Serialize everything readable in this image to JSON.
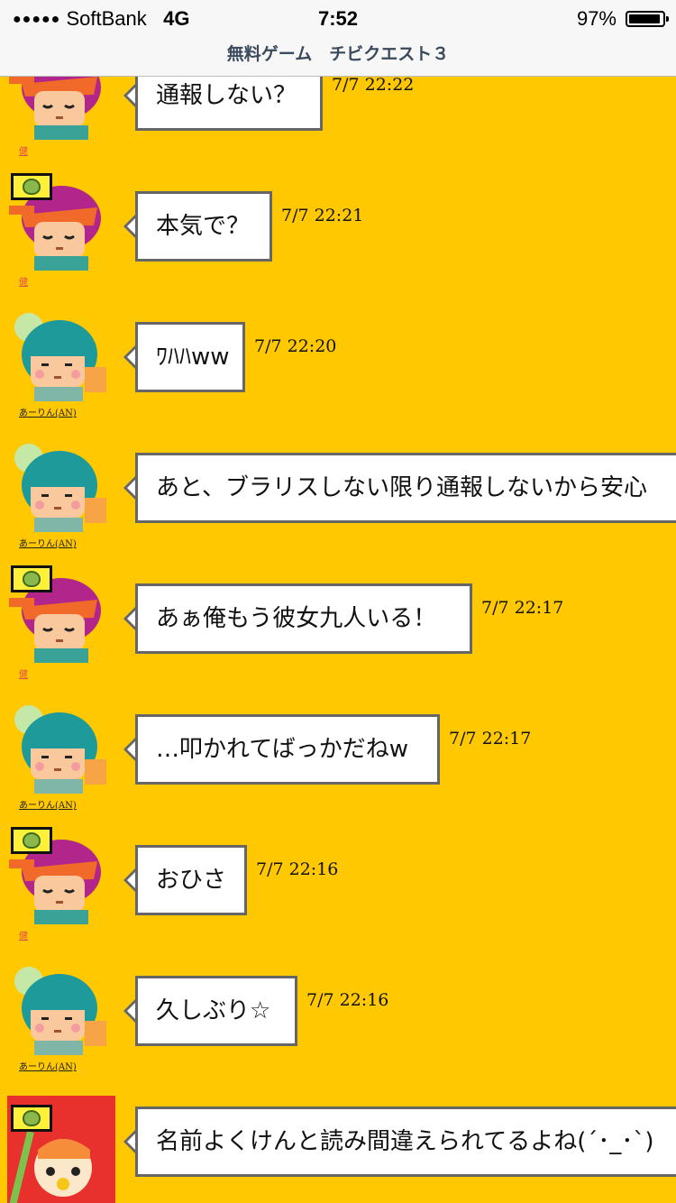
{
  "status_bar": {
    "carrier": "SoftBank",
    "network": "4G",
    "time": "7:52",
    "battery": "97%"
  },
  "header": {
    "title": "無料ゲーム　チビクエスト３"
  },
  "messages": [
    {
      "user": "健",
      "user_color": "#e84c4c",
      "avatar": "red-hair-avatar",
      "text": "通報しない？",
      "timestamp": "7/7 22:22"
    },
    {
      "user": "健",
      "user_color": "#e84c4c",
      "avatar": "red-hair-avatar",
      "text": "本気で？",
      "timestamp": "7/7 22:21"
    },
    {
      "user": "あーりん(AN)",
      "user_color": "#222222",
      "avatar": "teal-hair-avatar",
      "text": "ﾜﾊﾊww",
      "timestamp": "7/7 22:20"
    },
    {
      "user": "あーりん(AN)",
      "user_color": "#222222",
      "avatar": "teal-hair-avatar",
      "text": "あと、ブラリスしない限り通報しないから安心",
      "timestamp": ""
    },
    {
      "user": "健",
      "user_color": "#e84c4c",
      "avatar": "red-hair-avatar",
      "text": "あぁ俺もう彼女九人いる！",
      "timestamp": "7/7 22:17"
    },
    {
      "user": "あーりん(AN)",
      "user_color": "#222222",
      "avatar": "teal-hair-avatar",
      "text": "…叩かれてばっかだねw",
      "timestamp": "7/7 22:17"
    },
    {
      "user": "健",
      "user_color": "#e84c4c",
      "avatar": "red-hair-avatar",
      "text": "おひさ",
      "timestamp": "7/7 22:16"
    },
    {
      "user": "あーりん(AN)",
      "user_color": "#222222",
      "avatar": "teal-hair-avatar",
      "text": "久しぶり☆",
      "timestamp": "7/7 22:16"
    },
    {
      "user": "",
      "user_color": "#222222",
      "avatar": "red-hood-avatar",
      "text": "名前よくけんと読み間違えられてるよね(´･_･`)",
      "timestamp": ""
    }
  ],
  "colors": {
    "background": "#ffc800",
    "bubble_border": "#666666",
    "header_text": "#3a4a5c"
  }
}
